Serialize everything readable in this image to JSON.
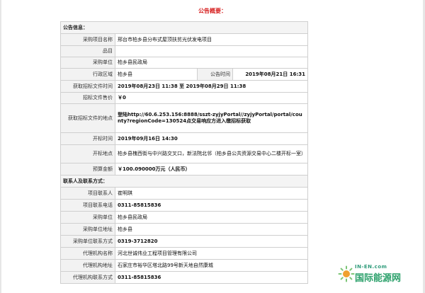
{
  "page": {
    "title": "公告概要："
  },
  "notice_info": {
    "section_label": "公告信息：",
    "rows": {
      "project_name": {
        "label": "采购项目名称",
        "value": "邢台市柏乡县分布式屋顶扶贫光伏发电项目"
      },
      "item_category": {
        "label": "品目",
        "value": ""
      },
      "purchasing_unit": {
        "label": "采购单位",
        "value": "柏乡县民政局"
      },
      "admin_region": {
        "label": "行政区域",
        "value": "柏乡县",
        "pub_label": "公告时间",
        "pub_value": "2019年08月21日 16:31"
      },
      "doc_time": {
        "label": "获取招标文件时间",
        "value": "2019年08月23日 11:38 至 2019年08月29日 11:38"
      },
      "doc_price": {
        "label": "招标文件售价",
        "value": "￥0"
      },
      "doc_location": {
        "label": "获取招标文件的地点",
        "value": "登陆http://60.6.253.156:8888/sszt-zyjyPortal//zyjyPortal/portal/county?regionCode=130524点交易响应方进入缴招标获取"
      },
      "open_time": {
        "label": "开标时间",
        "value": "2019年09月16日 14:30"
      },
      "open_location": {
        "label": "开标地点",
        "value": "柏乡县槐西街与中兴路交叉口，新法院北邻（柏乡县公共资源交易中心二楼开标一室）"
      },
      "budget": {
        "label": "预算金额",
        "value": "￥100.090000万元（人民币）"
      }
    }
  },
  "contact_info": {
    "section_label": "联系人及联系方式：",
    "rows": {
      "project_contact": {
        "label": "项目联系人",
        "value": "崔明琪"
      },
      "project_phone": {
        "label": "项目联系电话",
        "value": "0311-85815836"
      },
      "purchasing_unit": {
        "label": "采购单位",
        "value": "柏乡县民政局"
      },
      "purchasing_address": {
        "label": "采购单位地址",
        "value": "柏乡县"
      },
      "purchasing_contact": {
        "label": "采购单位联系方式",
        "value": "0319-3712820"
      },
      "agency_name": {
        "label": "代理机构名称",
        "value": "河北世诚伟业工程项目管理有限公司"
      },
      "agency_address": {
        "label": "代理机构地址",
        "value": "石家庄市裕华区塔北路99号新天地自然康城"
      },
      "agency_contact": {
        "label": "代理机构联系方式",
        "value": "0311-85815836"
      }
    }
  },
  "watermark": {
    "site": "IN-EN.com",
    "name": "国际能源网",
    "colors": {
      "primary": "#2aa06a",
      "accent": "#f0a030"
    }
  }
}
